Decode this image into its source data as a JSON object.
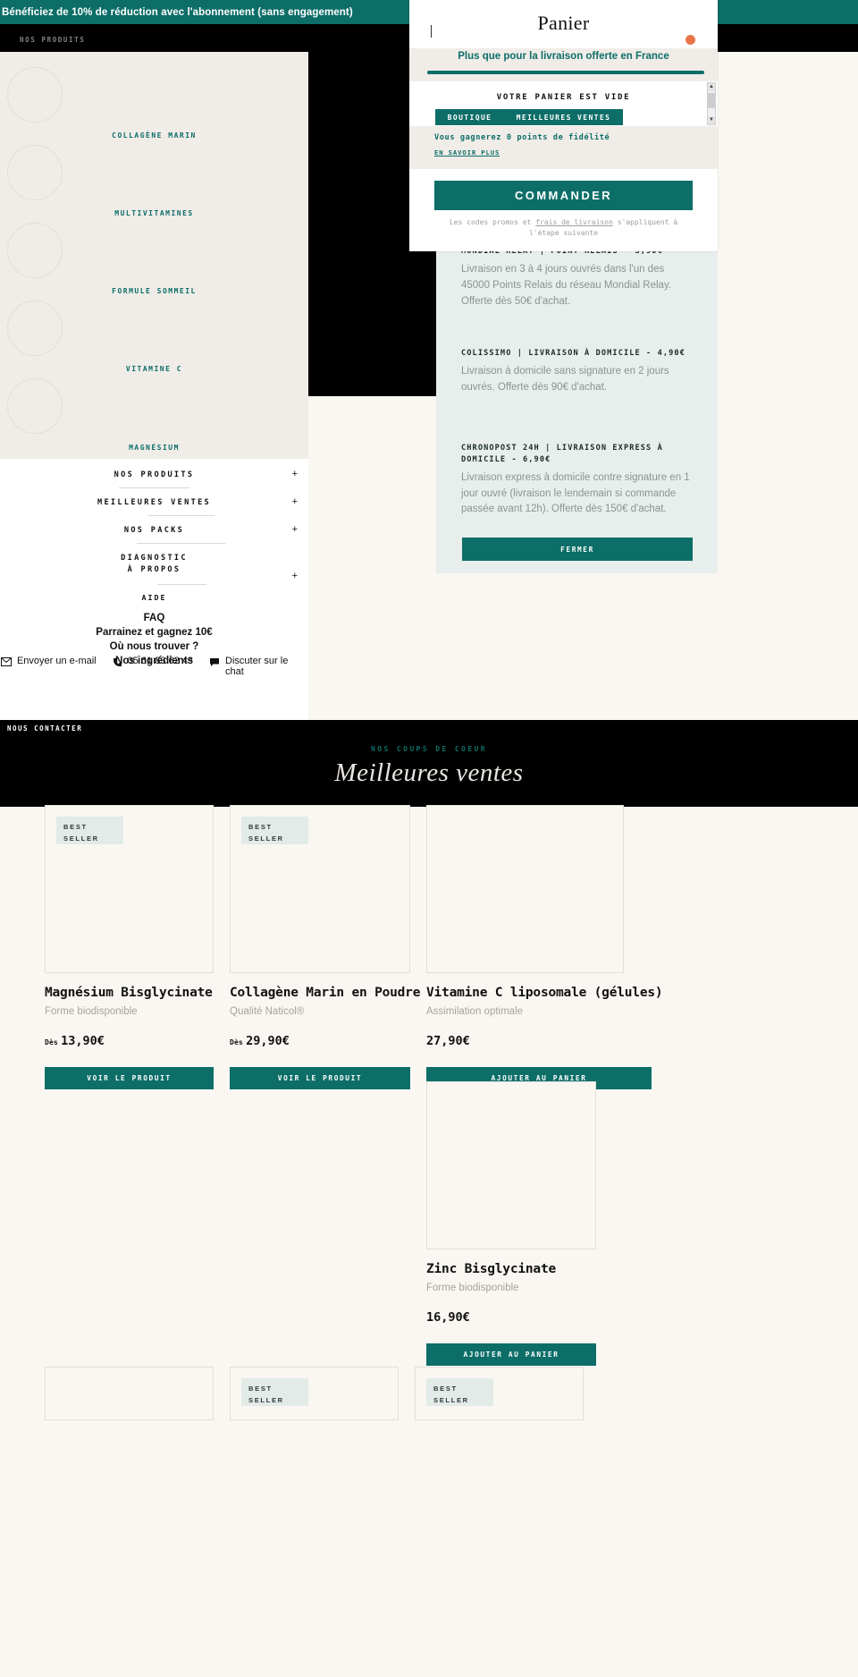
{
  "announcement": {
    "text": "Bénéficiez de 10% de réduction avec l'abonnement (sans engagement)"
  },
  "header": {
    "nav_label": "NOS PRODUITS"
  },
  "mega_menu": {
    "links": [
      {
        "label": "COLLAGÈNE MARIN"
      },
      {
        "label": "MULTIVITAMINES"
      },
      {
        "label": "FORMULE SOMMEIL"
      },
      {
        "label": "VITAMINE C"
      },
      {
        "label": "MAGNÉSIUM"
      }
    ]
  },
  "nav_drawer": {
    "rows": [
      {
        "label": "NOS PRODUITS",
        "expand": "+"
      },
      {
        "label": "MEILLEURES VENTES",
        "expand": "+"
      },
      {
        "label": "NOS PACKS",
        "expand": "+"
      },
      {
        "label": "DIAGNOSTIC"
      },
      {
        "label": "À PROPOS",
        "expand": "+"
      }
    ],
    "aide_label": "AIDE",
    "links": [
      {
        "label": "FAQ"
      },
      {
        "label": "Parrainez et gagnez 10€"
      },
      {
        "label": "Où nous trouver ?"
      },
      {
        "label": "Nos ingrédients"
      }
    ],
    "contacts": [
      {
        "icon": "mail-icon",
        "label": "Envoyer un e-mail"
      },
      {
        "icon": "phone-icon",
        "label": "05 61 83 62 43"
      },
      {
        "icon": "chat-icon",
        "label": "Discuter sur le chat"
      }
    ],
    "footer_label": "NOUS CONTACTER"
  },
  "cart": {
    "title": "Panier",
    "free_shipping_text": "Plus que pour la livraison offerte en France",
    "progress_percent": 100,
    "empty_text": "VOTRE PANIER EST VIDE",
    "chips": [
      {
        "label": "BOUTIQUE"
      },
      {
        "label": "MEILLEURES VENTES"
      }
    ],
    "loyalty_text": "Vous gagnerez 0 points de fidélité",
    "loyalty_link": "EN SAVOIR PLUS",
    "checkout_label": "COMMANDER",
    "note_a": "Les codes promos et ",
    "note_b": "frais de livraison",
    "note_c": " s'appliquent à l'étape suivante"
  },
  "shipping_panel": {
    "items": [
      {
        "title": "MONDIAL RELAY | POINT RELAIS - 3,90€",
        "desc": "Livraison en 3 à 4 jours ouvrés dans l'un des 45000 Points Relais du réseau Mondial Relay. Offerte dès 50€ d'achat."
      },
      {
        "title": "COLISSIMO | LIVRAISON À DOMICILE - 4,90€",
        "desc": "Livraison à domicile sans signature en 2 jours ouvrés. Offerte dès 90€ d'achat."
      },
      {
        "title": "CHRONOPOST 24H | LIVRAISON EXPRESS À DOMICILE - 6,90€",
        "desc": "Livraison express à domicile contre signature en 1 jour ouvré (livraison le lendemain si commande passée avant 12h). Offerte dès 150€ d'achat."
      }
    ],
    "close_label": "FERMER"
  },
  "bestsellers": {
    "eyebrow": "NOS COUPS DE COEUR",
    "title": "Meilleures ventes",
    "badge_line1": "BEST",
    "badge_line2": "SELLER",
    "from_label": "Dès",
    "products": [
      {
        "name": "Magnésium Bisglycinate",
        "subtitle": "Forme biodisponible",
        "price": "13,90€",
        "has_from": true,
        "badge": true,
        "cta": "VOIR LE PRODUIT"
      },
      {
        "name": "Collagène Marin en Poudre",
        "subtitle": "Qualité Naticol®",
        "price": "29,90€",
        "has_from": true,
        "badge": true,
        "cta": "VOIR LE PRODUIT"
      },
      {
        "name": "Vitamine C liposomale (gélules)",
        "subtitle": "Assimilation optimale",
        "price": "27,90€",
        "has_from": false,
        "badge": false,
        "cta": "AJOUTER AU PANIER"
      },
      {
        "name": "Zinc Bisglycinate",
        "subtitle": "Forme biodisponible",
        "price": "16,90€",
        "has_from": false,
        "badge": false,
        "cta": "AJOUTER AU PANIER"
      }
    ]
  },
  "colors": {
    "teal": "#0d6e68",
    "cream": "#faf7f3",
    "beige": "#f0ece8",
    "accent_dot": "#e8764a"
  }
}
